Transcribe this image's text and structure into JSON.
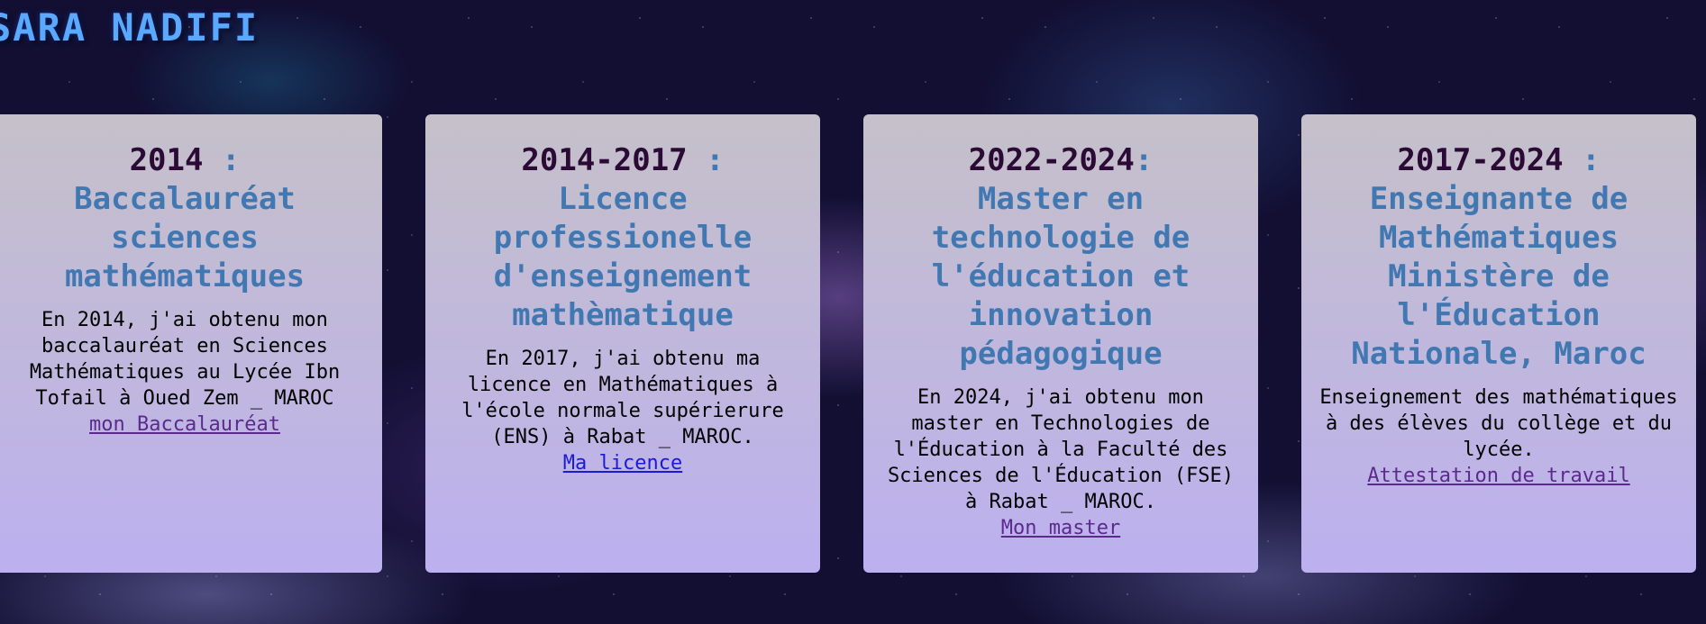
{
  "site": {
    "title": "SARA NADIFI"
  },
  "cards": [
    {
      "year": "2014",
      "separator": " :",
      "title": "Baccalauréat sciences mathématiques",
      "description": "En 2014, j'ai obtenu mon baccalauréat en Sciences Mathématiques au Lycée Ibn Tofail à Oued Zem _ MAROC",
      "link_label": "mon Baccalauréat"
    },
    {
      "year": "2014-2017",
      "separator": " :",
      "title": "Licence professionelle d'enseignement mathèmatique",
      "description": "En 2017, j'ai obtenu ma licence en Mathématiques à l'école normale supérierure (ENS) à Rabat _ MAROC.",
      "link_label": "Ma licence"
    },
    {
      "year": "2022-2024",
      "separator": ":",
      "title": "Master en technologie de l'éducation et innovation pédagogique",
      "description": "En 2024, j'ai obtenu mon master en Technologies de l'Éducation à la Faculté des Sciences de l'Éducation (FSE) à Rabat _ MAROC.",
      "link_label": "Mon master"
    },
    {
      "year": "2017-2024",
      "separator": " :",
      "title": "Enseignante de Mathématiques Ministère de l'Éducation Nationale, Maroc",
      "description": "Enseignement des mathématiques à des élèves du collège et du lycée.",
      "link_label": "Attestation de travail"
    }
  ],
  "colors": {
    "title": "#5aa9ff",
    "year": "#2b0b36",
    "heading": "#4178b2",
    "link_visited": "#5c2a8c",
    "link_unvisited": "#1b1bd6",
    "card_top": "#c5c0c9",
    "card_bottom": "#bcb0ef",
    "background": "#120f33"
  }
}
